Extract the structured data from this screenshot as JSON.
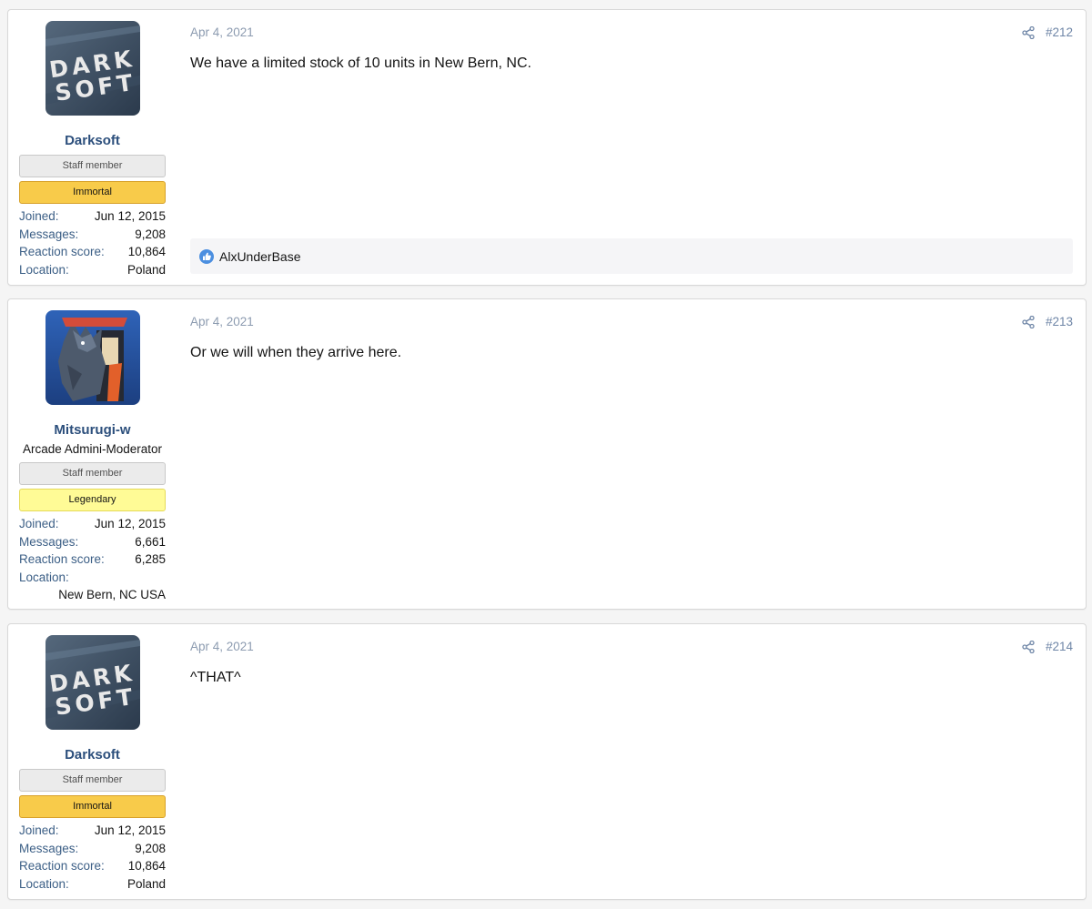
{
  "posts": [
    {
      "username": "Darksoft",
      "user_title": "",
      "banners": {
        "staff": "Staff member",
        "rank": "Immortal"
      },
      "stats": {
        "joined_label": "Joined:",
        "joined": "Jun 12, 2015",
        "messages_label": "Messages:",
        "messages": "9,208",
        "reaction_label": "Reaction score:",
        "reaction": "10,864",
        "location_label": "Location:",
        "location": "Poland"
      },
      "date": "Apr 4, 2021",
      "number": "#212",
      "body": "We have a limited stock of 10 units in New Bern, NC.",
      "reaction_user": "AlxUnderBase"
    },
    {
      "username": "Mitsurugi-w",
      "user_title": "Arcade Admini-Moderator",
      "banners": {
        "staff": "Staff member",
        "rank": "Legendary"
      },
      "stats": {
        "joined_label": "Joined:",
        "joined": "Jun 12, 2015",
        "messages_label": "Messages:",
        "messages": "6,661",
        "reaction_label": "Reaction score:",
        "reaction": "6,285",
        "location_label": "Location:",
        "location": "New Bern, NC USA"
      },
      "date": "Apr 4, 2021",
      "number": "#213",
      "body": "Or we will when they arrive here."
    },
    {
      "username": "Darksoft",
      "user_title": "",
      "banners": {
        "staff": "Staff member",
        "rank": "Immortal"
      },
      "stats": {
        "joined_label": "Joined:",
        "joined": "Jun 12, 2015",
        "messages_label": "Messages:",
        "messages": "9,208",
        "reaction_label": "Reaction score:",
        "reaction": "10,864",
        "location_label": "Location:",
        "location": "Poland"
      },
      "date": "Apr 4, 2021",
      "number": "#214",
      "body": "^THAT^"
    }
  ],
  "avatars": {
    "darksoft_logo_top": "DARK",
    "darksoft_logo_bottom": "SOFT"
  },
  "icons": {
    "share": "share-icon",
    "like": "like-icon"
  },
  "colors": {
    "username": "#2c4f7c",
    "immortal_banner": "#f8cb4a",
    "legendary_banner": "#fffb96",
    "staff_banner": "#ebebeb",
    "meta_text": "#8c9bb0"
  }
}
